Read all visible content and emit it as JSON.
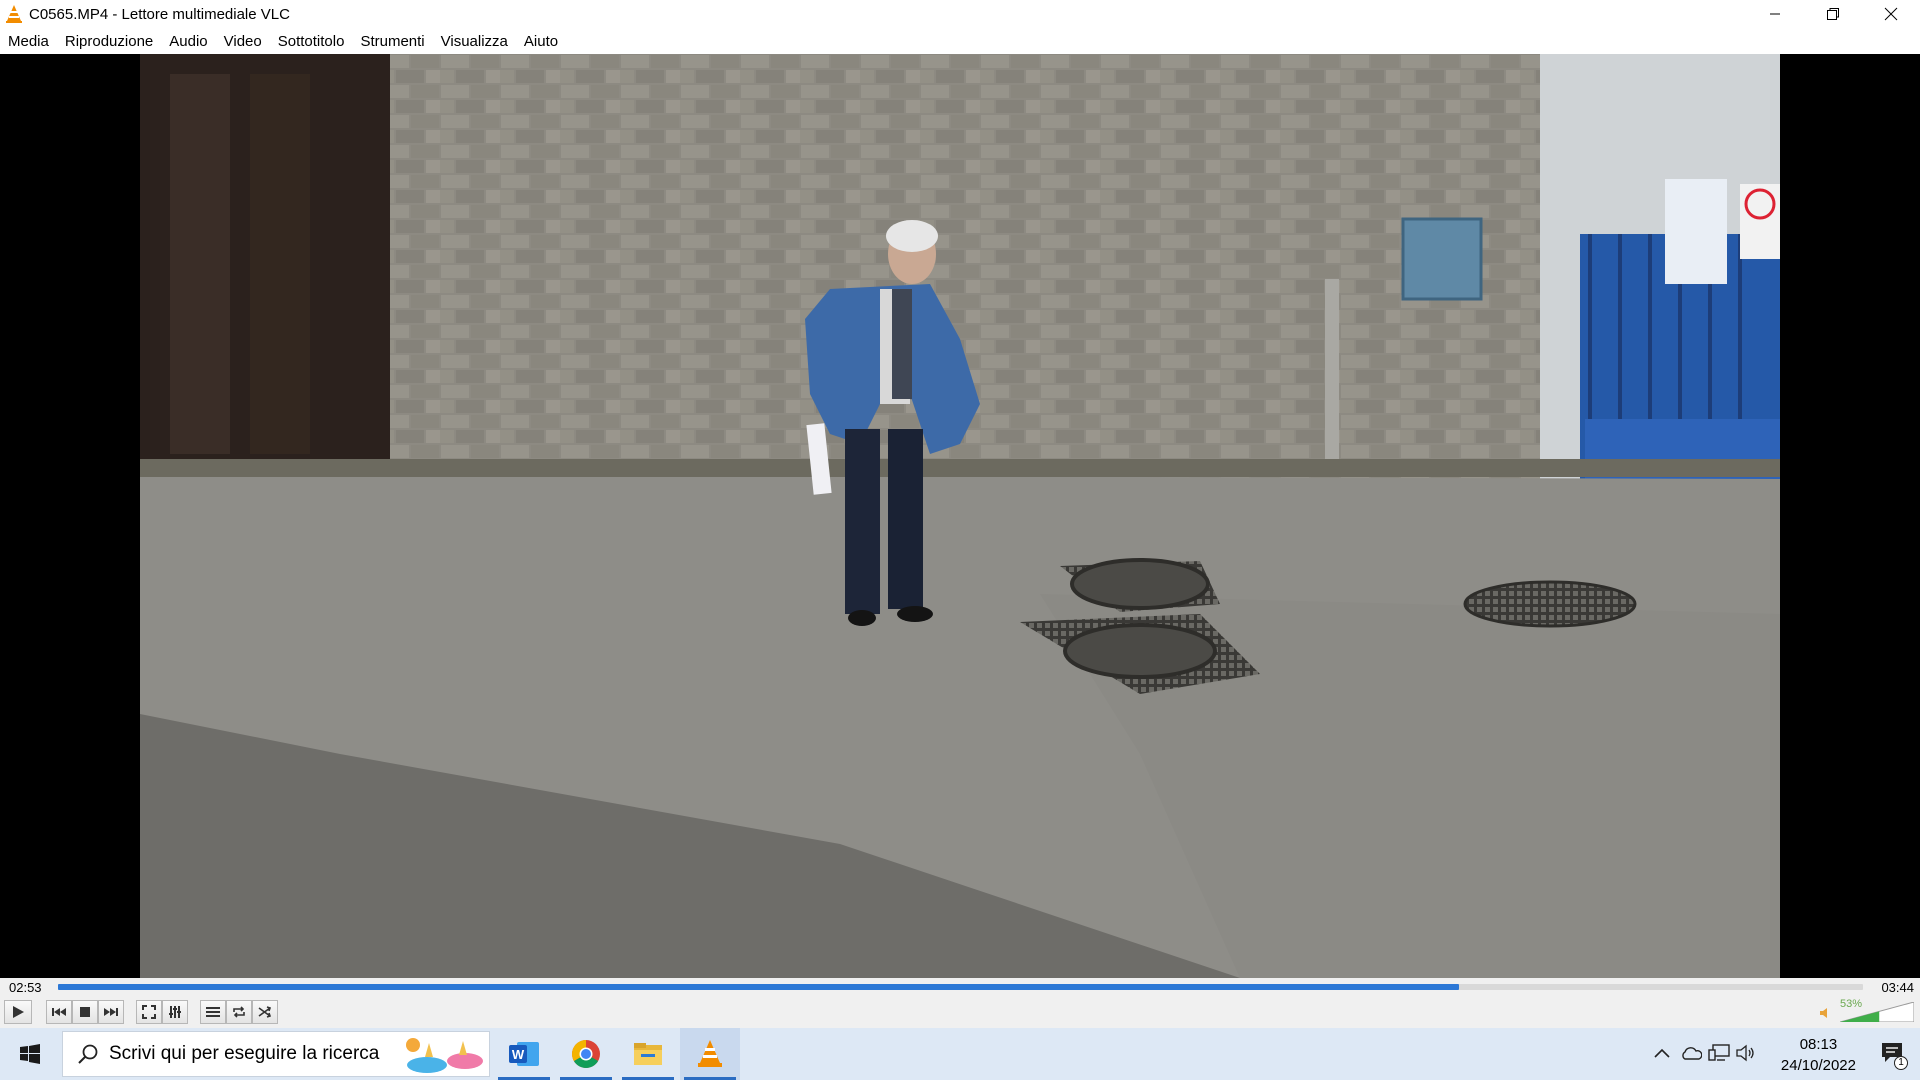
{
  "window": {
    "title": "C0565.MP4 - Lettore multimediale VLC"
  },
  "menu": {
    "items": [
      "Media",
      "Riproduzione",
      "Audio",
      "Video",
      "Sottotitolo",
      "Strumenti",
      "Visualizza",
      "Aiuto"
    ]
  },
  "player": {
    "elapsed": "02:53",
    "total": "03:44",
    "progress": 0.776,
    "volume_label": "53%",
    "volume": 0.53
  },
  "taskbar": {
    "search_placeholder": "Scrivi qui per eseguire la ricerca",
    "time": "08:13",
    "date": "24/10/2022",
    "notification_count": "1"
  },
  "colors": {
    "accent": "#2c78d6",
    "vlc_orange": "#f28c00",
    "taskbar": "#dde8f5"
  }
}
